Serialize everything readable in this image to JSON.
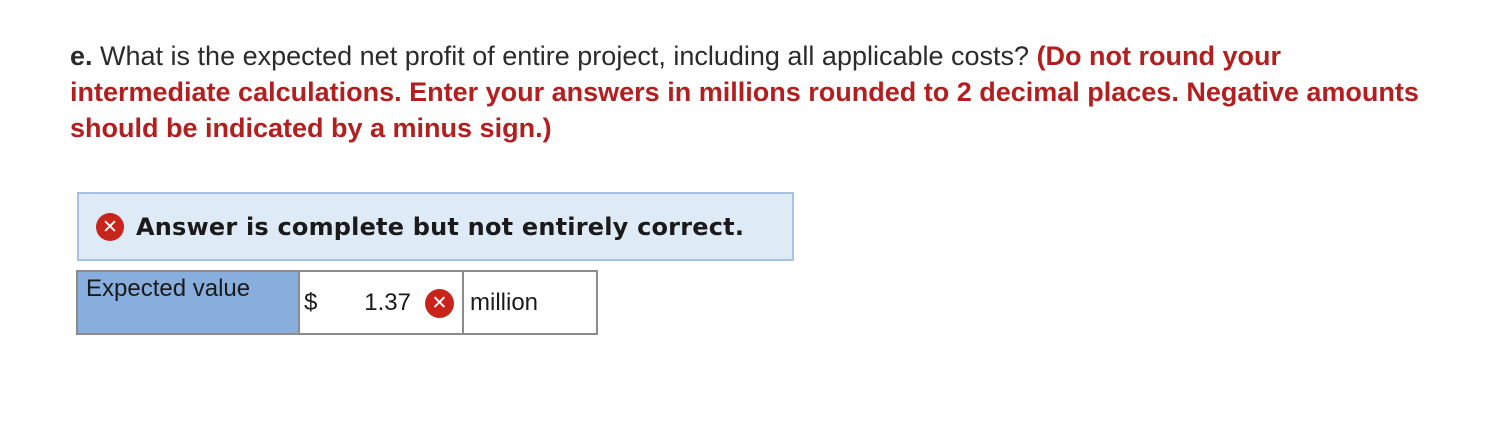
{
  "question": {
    "letter": "e.",
    "text": " What is the expected net profit of entire project, including all applicable costs? ",
    "instructions": "(Do not round your intermediate calculations. Enter your answers in millions rounded to 2 decimal places. Negative amounts should be indicated by a minus sign.)"
  },
  "feedback": {
    "icon": "x-circle-icon",
    "message": "Answer is complete but not entirely correct."
  },
  "answer_row": {
    "label": "Expected value",
    "currency": "$",
    "value": "1.37",
    "status_icon": "x-circle-icon",
    "unit": "million"
  },
  "icons": {
    "incorrect_glyph": "✕"
  },
  "colors": {
    "instruction_red": "#b31f1f",
    "error_red": "#c8241b",
    "feedback_bg": "#dfeaf7",
    "label_cell_bg": "#88aede"
  }
}
